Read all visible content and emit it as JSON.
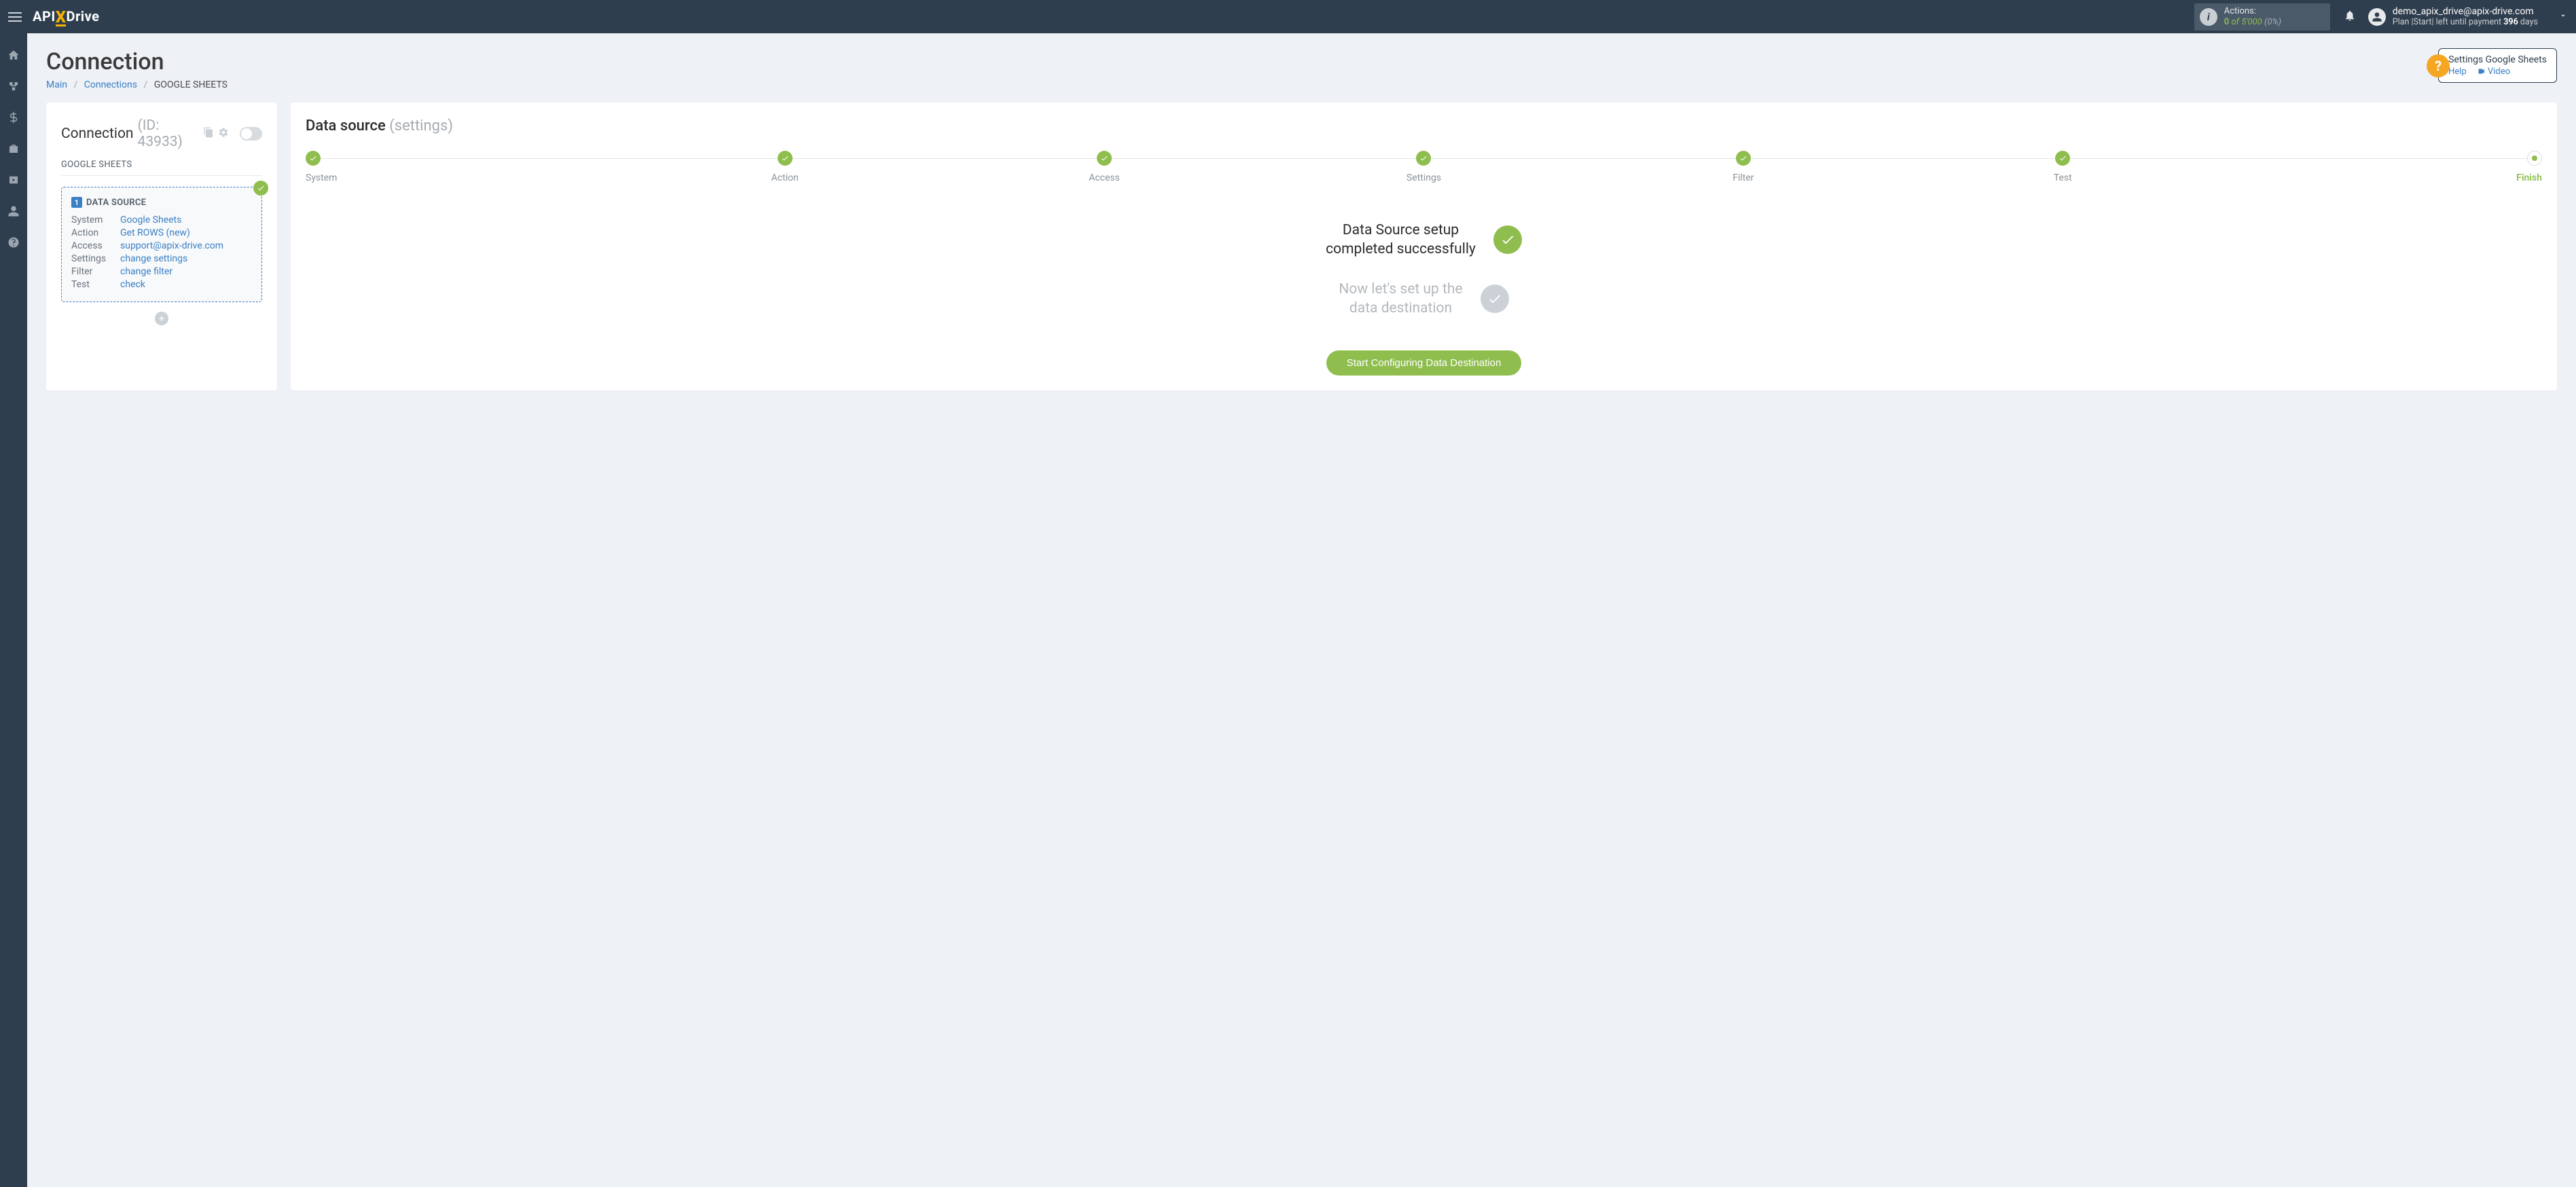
{
  "header": {
    "brand_api": "API",
    "brand_x": "X",
    "brand_drive": "Drive",
    "actions_label": "Actions:",
    "actions_used": "0",
    "actions_of": "of",
    "actions_total": "5'000",
    "actions_pct": "(0%)",
    "user_email": "demo_apix_drive@apix-drive.com",
    "plan_prefix": "Plan |Start| left until payment",
    "plan_days_num": "396",
    "plan_days_suffix": "days"
  },
  "page": {
    "title": "Connection",
    "crumb_main": "Main",
    "crumb_connections": "Connections",
    "crumb_current": "GOOGLE SHEETS"
  },
  "help": {
    "title": "Settings Google Sheets",
    "help_label": "Help",
    "video_label": "Video"
  },
  "left": {
    "conn_label": "Connection",
    "conn_id": "(ID: 43933)",
    "service_label": "GOOGLE SHEETS",
    "ds_badge": "1",
    "ds_title": "DATA SOURCE",
    "rows": {
      "system_k": "System",
      "system_v": "Google Sheets",
      "action_k": "Action",
      "action_v": "Get ROWS (new)",
      "access_k": "Access",
      "access_v": "support@apix-drive.com",
      "settings_k": "Settings",
      "settings_v": "change settings",
      "filter_k": "Filter",
      "filter_v": "change filter",
      "test_k": "Test",
      "test_v": "check"
    }
  },
  "right": {
    "title": "Data source",
    "title_sub": "(settings)",
    "steps": [
      "System",
      "Action",
      "Access",
      "Settings",
      "Filter",
      "Test",
      "Finish"
    ],
    "msg_done_l1": "Data Source setup",
    "msg_done_l2": "completed successfully",
    "msg_next_l1": "Now let's set up the",
    "msg_next_l2": "data destination",
    "cta": "Start Configuring Data Destination"
  }
}
